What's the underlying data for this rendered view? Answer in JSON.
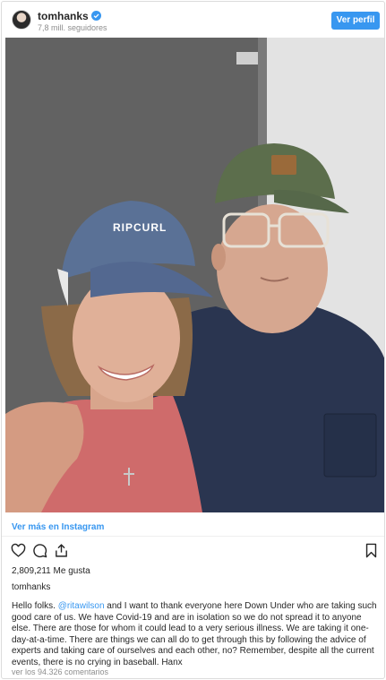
{
  "header": {
    "username": "tomhanks",
    "followers": "7,8 mill. seguidores",
    "view_profile_label": "Ver perfil"
  },
  "photo": {
    "cap_logo": "RIPCURL"
  },
  "view_more_label": "Ver más en Instagram",
  "likes_label": "2,809,211 Me gusta",
  "caption": {
    "owner": "tomhanks",
    "text_before": "Hello folks. ",
    "mention": "@ritawilson",
    "text_after": " and I want to thank everyone here Down Under who are taking such good care of us. We have Covid-19 and are in isolation so we do not spread it to anyone else. There are those for whom it could lead to a very serious illness. We are taking it one-day-at-a-time. There are things we can all do to get through this by following the advice of experts and taking care of ourselves and each other, no? Remember, despite all the current events, there is no crying in baseball. Hanx"
  },
  "comments_label": "ver los 94.326 comentarios",
  "colors": {
    "accent": "#3897f0",
    "text": "#262626",
    "muted": "#8e8e8e",
    "border": "#dbdbdb"
  },
  "icons": [
    "verified-badge-icon",
    "heart-icon",
    "comment-icon",
    "share-icon",
    "bookmark-icon"
  ]
}
